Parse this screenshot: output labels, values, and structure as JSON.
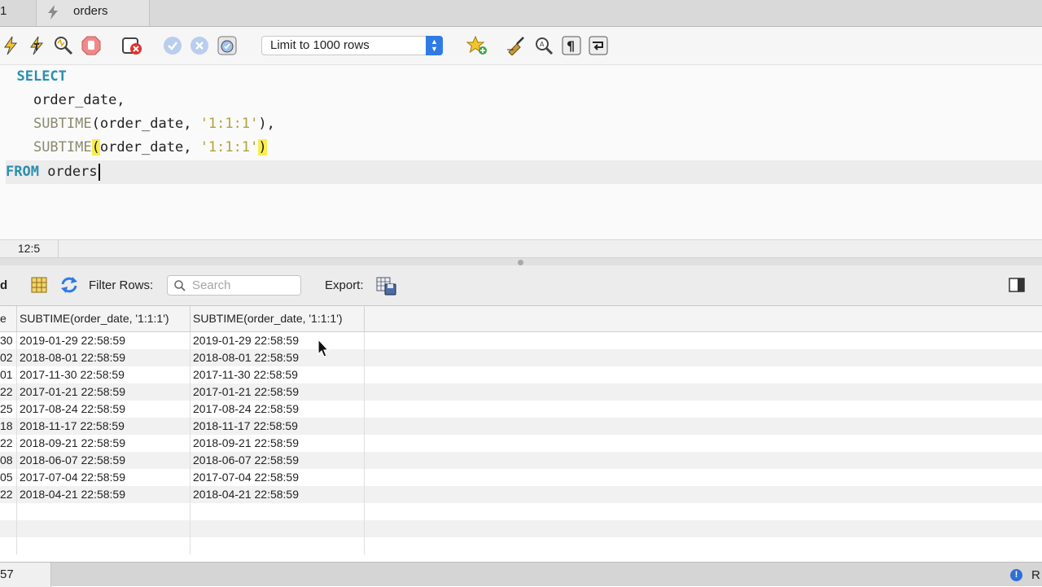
{
  "tabs": {
    "previous_label": "1",
    "active_label": "orders"
  },
  "toolbar": {
    "limit_selected": "Limit to 1000 rows",
    "icons": [
      "execute-icon",
      "execute-current-icon",
      "explain-icon",
      "stop-icon",
      "error-toggle-icon",
      "commit-icon",
      "rollback-icon",
      "autocommit-icon",
      "add-snippet-icon",
      "beautify-icon",
      "find-icon",
      "invisible-chars-icon",
      "wrap-icon"
    ],
    "accent_color": "#2f7be6"
  },
  "editor": {
    "lines": [
      {
        "kw": "SELECT"
      },
      {
        "indent": "    ",
        "text": "order_date,"
      },
      {
        "indent": "    ",
        "fn": "SUBTIME",
        "open": "(",
        "arg": "order_date, ",
        "str": "'1:1:1'",
        "close": ")",
        "tail": ","
      },
      {
        "indent": "    ",
        "fn": "SUBTIME",
        "open": "(",
        "arg": "order_date, ",
        "str": "'1:1:1'",
        "close": ")",
        "tail": ""
      },
      {
        "kw": "FROM",
        "text": " orders"
      }
    ],
    "colors": {
      "keyword": "#2a8fae",
      "function": "#8a8a70",
      "string": "#b0a23c",
      "bracket_highlight": "#f7ee4f"
    }
  },
  "status": {
    "cursor_position": "12:5"
  },
  "results_toolbar": {
    "left_cut_label": "d",
    "filter_label": "Filter Rows:",
    "search_placeholder": "Search",
    "export_label": "Export:"
  },
  "grid": {
    "columns": [
      "e",
      "SUBTIME(order_date, '1:1:1')",
      "SUBTIME(order_date, '1:1:1')"
    ],
    "rows": [
      [
        "30",
        "2019-01-29 22:58:59",
        "2019-01-29 22:58:59"
      ],
      [
        "02",
        "2018-08-01 22:58:59",
        "2018-08-01 22:58:59"
      ],
      [
        "01",
        "2017-11-30 22:58:59",
        "2017-11-30 22:58:59"
      ],
      [
        "22",
        "2017-01-21 22:58:59",
        "2017-01-21 22:58:59"
      ],
      [
        "25",
        "2017-08-24 22:58:59",
        "2017-08-24 22:58:59"
      ],
      [
        "18",
        "2018-11-17 22:58:59",
        "2018-11-17 22:58:59"
      ],
      [
        "22",
        "2018-09-21 22:58:59",
        "2018-09-21 22:58:59"
      ],
      [
        "08",
        "2018-06-07 22:58:59",
        "2018-06-07 22:58:59"
      ],
      [
        "05",
        "2017-07-04 22:58:59",
        "2017-07-04 22:58:59"
      ],
      [
        "22",
        "2018-04-21 22:58:59",
        "2018-04-21 22:58:59"
      ]
    ],
    "empty_rows": 3
  },
  "bottom_status": {
    "left_text": "57",
    "right_text": "R"
  }
}
